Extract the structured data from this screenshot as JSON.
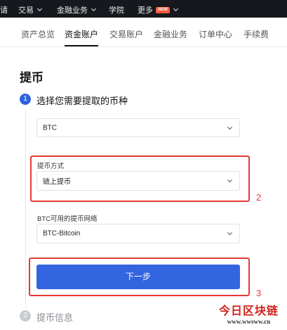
{
  "topnav": {
    "partial_item": "请",
    "items": [
      {
        "label": "交易"
      },
      {
        "label": "金融业务"
      },
      {
        "label": "学院"
      },
      {
        "label": "更多",
        "badge": "NEW"
      }
    ]
  },
  "subnav": {
    "tabs": [
      "资产总览",
      "资金账户",
      "交易账户",
      "金融业务",
      "订单中心",
      "手续费"
    ],
    "active_tab": "资金账户"
  },
  "page": {
    "title": "提币"
  },
  "steps": [
    {
      "number": "1",
      "title": "选择您需要提取的币种",
      "status": "active"
    },
    {
      "number": "2",
      "title": "提币信息",
      "status": "inactive"
    }
  ],
  "form": {
    "coin_select": {
      "value": "BTC"
    },
    "method": {
      "label": "提币方式",
      "value": "链上提币"
    },
    "network": {
      "label": "BTC可用的提币网络",
      "value": "BTC-Bitcoin"
    },
    "next_button": "下一步"
  },
  "annotations": {
    "box_2": "2",
    "box_3": "3"
  },
  "watermark": {
    "main": "今日区块链",
    "sub": "www.wwsww.cn"
  },
  "colors": {
    "accent": "#3465e0",
    "annotation_red": "#e53935",
    "nav_bg": "#16181d"
  }
}
